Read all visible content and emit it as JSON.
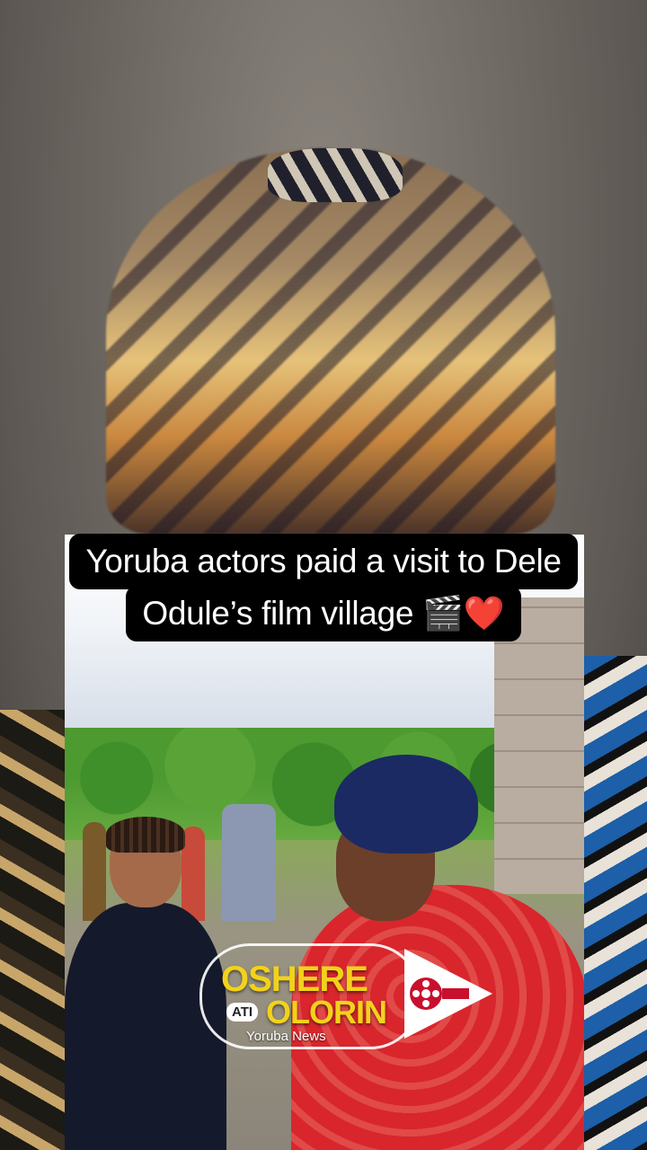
{
  "caption": {
    "line1": "Yoruba actors paid a visit to Dele",
    "line2": "Odule’s film village 🎬❤️"
  },
  "watermark": {
    "word1": "OSHERE",
    "badge": "ATI",
    "word2": "OLORIN",
    "subtitle": "Yoruba News",
    "text_color": "#f2d21a",
    "icon": "film-reel-play-icon"
  }
}
